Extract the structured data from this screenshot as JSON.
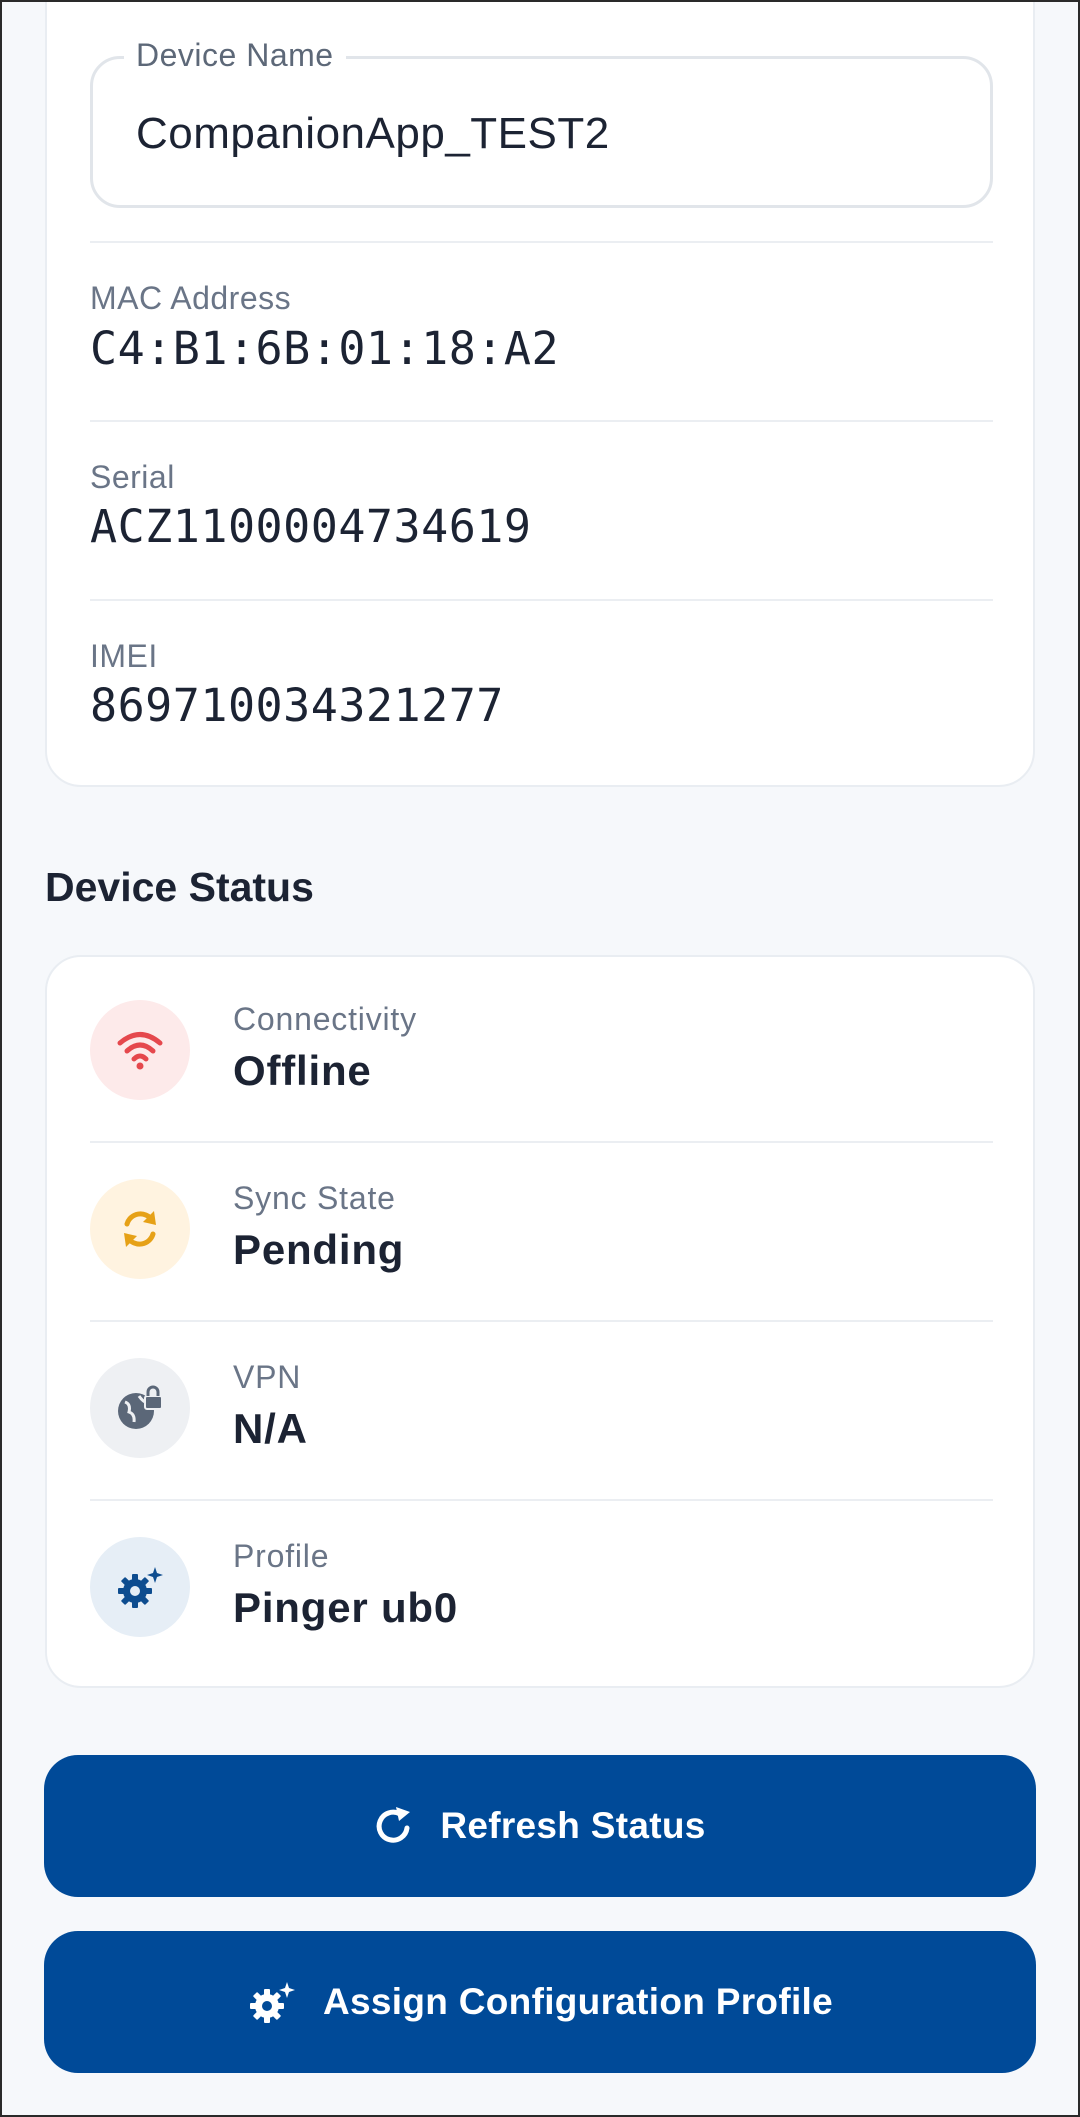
{
  "device_info": {
    "device_name": {
      "label": "Device Name",
      "value": "CompanionApp_TEST2"
    },
    "mac_address": {
      "label": "MAC Address",
      "value": "C4:B1:6B:01:18:A2"
    },
    "serial": {
      "label": "Serial",
      "value": "ACZ1100004734619"
    },
    "imei": {
      "label": "IMEI",
      "value": "869710034321277"
    }
  },
  "device_status": {
    "title": "Device Status",
    "items": [
      {
        "label": "Connectivity",
        "value": "Offline",
        "icon": "wifi-icon",
        "color": "#e5484d",
        "bg": "#fdeaea"
      },
      {
        "label": "Sync State",
        "value": "Pending",
        "icon": "sync-icon",
        "color": "#e6a117",
        "bg": "#fff3e0"
      },
      {
        "label": "VPN",
        "value": "N/A",
        "icon": "globe-lock-icon",
        "color": "#5b6778",
        "bg": "#eef0f3"
      },
      {
        "label": "Profile",
        "value": "Pinger ub0",
        "icon": "gear-sparkle-icon",
        "color": "#0d4c8f",
        "bg": "#e6eef6"
      }
    ]
  },
  "actions": {
    "refresh_label": "Refresh Status",
    "assign_label": "Assign Configuration Profile"
  },
  "colors": {
    "primary": "#004a98",
    "background": "#f6f8fb",
    "card": "#ffffff"
  }
}
